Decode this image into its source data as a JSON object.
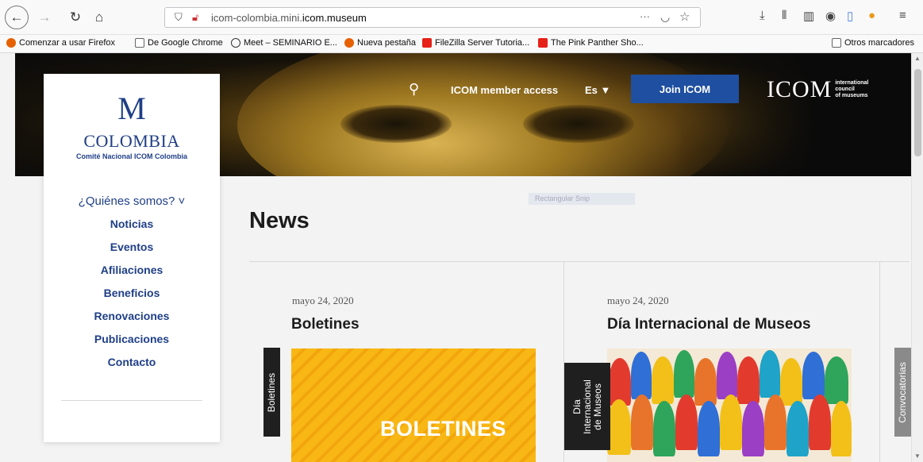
{
  "browser": {
    "url_prefix": "icom-colombia.mini.",
    "url_bold": "icom.museum",
    "url_menu": "···",
    "bookmarks": [
      "Comenzar a usar Firefox",
      "De Google Chrome",
      "Meet – SEMINARIO E...",
      "Nueva pestaña",
      "FileZilla Server Tutoria...",
      "The Pink Panther Sho..."
    ],
    "other_bookmarks": "Otros marcadores"
  },
  "header": {
    "member_access": "ICOM member access",
    "language": "Es ▼",
    "join_label": "Join ICOM",
    "icom_logo_text": "ICOM",
    "icom_tagline": [
      "international",
      "council",
      "of museums"
    ]
  },
  "sidebar": {
    "brand_mark": "M",
    "brand_name": "COLOMBIA",
    "brand_sub": "Comité Nacional ICOM Colombia",
    "menu": [
      "¿Quiénes somos? ˅",
      "Noticias",
      "Eventos",
      "Afiliaciones",
      "Beneficios",
      "Renovaciones",
      "Publicaciones",
      "Contacto"
    ]
  },
  "main": {
    "title": "News",
    "snip_hint": "Rectangular Snip",
    "cards": [
      {
        "date": "mayo 24, 2020",
        "title": "Boletines",
        "tab": "Boletines",
        "image_label": "BOLETINES"
      },
      {
        "date": "mayo 24, 2020",
        "title": "Día Internacional de Museos",
        "tab": "Día Internacional de Museos"
      }
    ],
    "next_tab": "Convocatorias"
  },
  "colors": {
    "brand_blue": "#1f3f87",
    "join_blue": "#1f4fa0",
    "tab_dark": "#1f1f1f",
    "tab_grey": "#8a8a8a"
  }
}
